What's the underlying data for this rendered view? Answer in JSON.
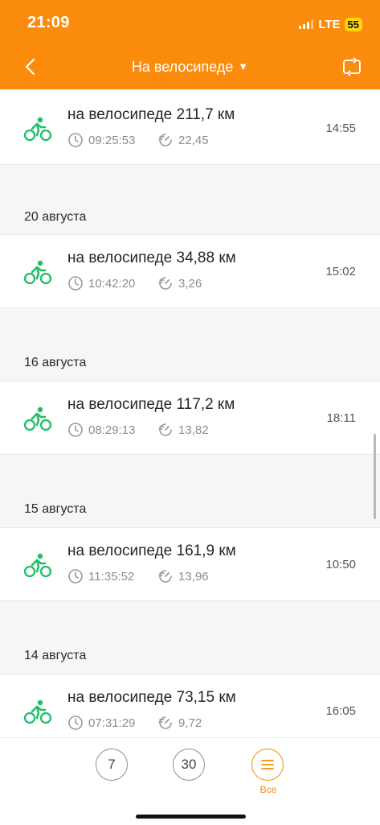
{
  "status_bar": {
    "time": "21:09",
    "network": "LTE",
    "battery": "55"
  },
  "nav": {
    "title": "На велосипеде",
    "caret": "▼"
  },
  "activities": [
    {
      "title": "на велосипеде 211,7 км",
      "duration": "09:25:53",
      "value": "22,45",
      "time": "14:55"
    },
    {
      "title": "на велосипеде 34,88 км",
      "duration": "10:42:20",
      "value": "3,26",
      "time": "15:02"
    },
    {
      "title": "на велосипеде 117,2 км",
      "duration": "08:29:13",
      "value": "13,82",
      "time": "18:11"
    },
    {
      "title": "на велосипеде 161,9 км",
      "duration": "11:35:52",
      "value": "13,96",
      "time": "10:50"
    },
    {
      "title": "на велосипеде 73,15 км",
      "duration": "07:31:29",
      "value": "9,72",
      "time": "16:05"
    }
  ],
  "dates": [
    "20 августа",
    "16 августа",
    "15 августа",
    "14 августа"
  ],
  "bottom": {
    "btn7": "7",
    "btn30": "30",
    "all_label": "Все"
  },
  "colors": {
    "accent": "#fa8b0d",
    "bike": "#1fbf6a"
  }
}
